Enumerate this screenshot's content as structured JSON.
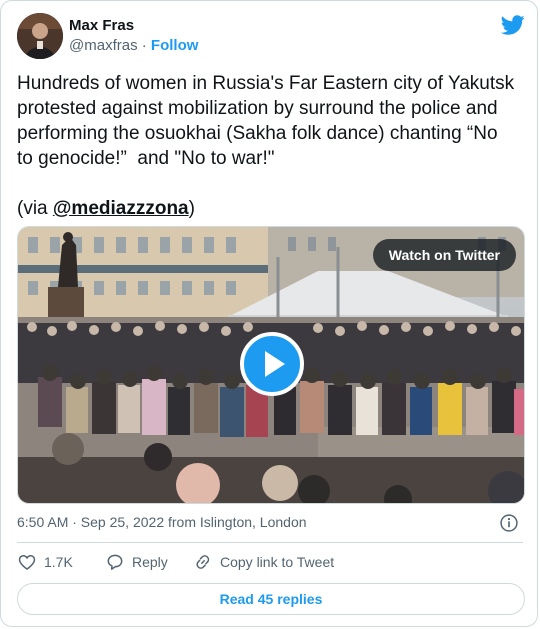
{
  "author": {
    "name": "Max Fras",
    "handle": "@maxfras",
    "separator": " · ",
    "follow_label": "Follow"
  },
  "tweet": {
    "text": "Hundreds of women in Russia's Far Eastern city of Yakutsk protested against mobilization by surround the police and performing the osuokhai (Sakha folk dance) chanting “No to genocide!”  and \"No to war!\"\n\n(via ",
    "mention": "@mediazzzona",
    "text_end": ")"
  },
  "media": {
    "watch_label": "Watch on Twitter"
  },
  "meta": {
    "timestamp": "6:50 AM · Sep 25, 2022 from Islington, London"
  },
  "actions": {
    "likes": "1.7K",
    "reply_label": "Reply",
    "copy_label": "Copy link to Tweet"
  },
  "read_replies_label": "Read 45 replies",
  "colors": {
    "accent": "#1d9bf0",
    "text": "#0f1419",
    "secondary": "#536471",
    "border": "#cfd9de"
  },
  "icons": {
    "brand": "twitter-bird-icon",
    "info": "info-icon",
    "like": "heart-icon",
    "reply": "reply-bubble-icon",
    "copy": "link-icon",
    "play": "play-icon"
  }
}
